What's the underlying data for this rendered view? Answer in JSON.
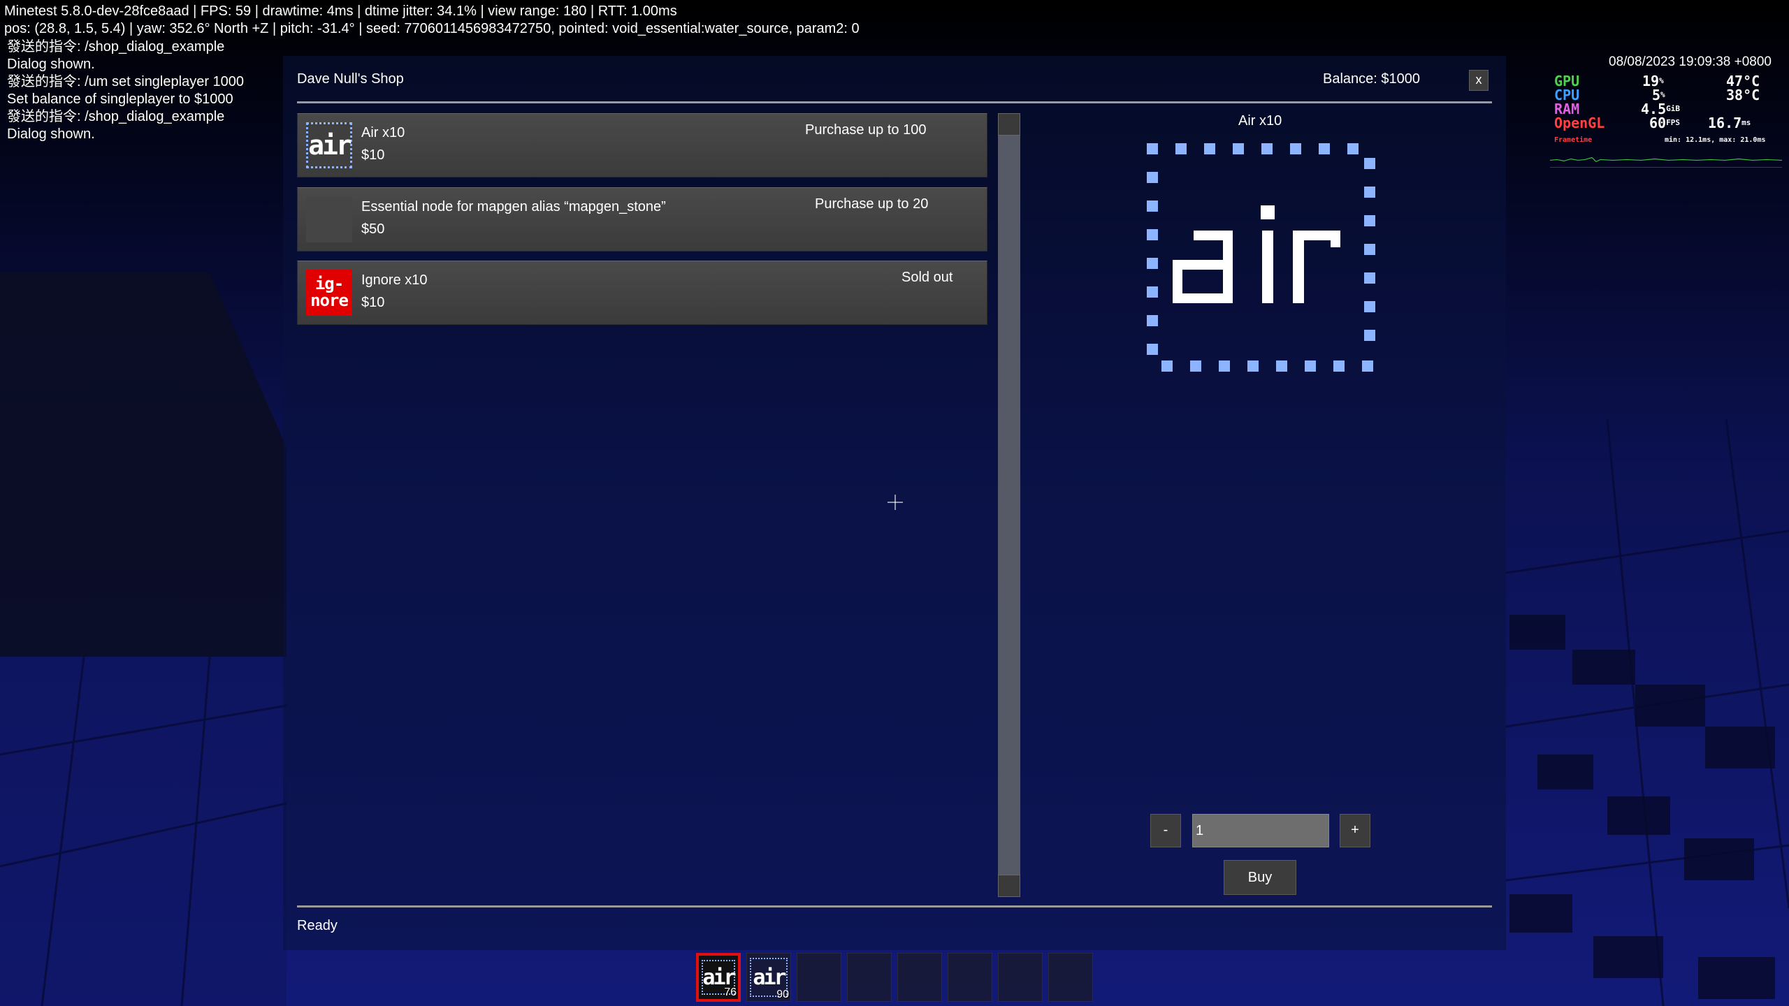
{
  "debug": {
    "line1": "Minetest 5.8.0-dev-28fce8aad | FPS: 59 | drawtime: 4ms | dtime jitter: 34.1% | view range: 180 | RTT: 1.00ms",
    "line2": "pos: (28.8, 1.5, 5.4) | yaw: 352.6° North +Z | pitch: -31.4° | seed: 7706011456983472750, pointed: void_essential:water_source, param2: 0"
  },
  "chat": [
    "發送的指令: /shop_dialog_example",
    "Dialog shown.",
    "發送的指令: /um set singleplayer 1000",
    "Set balance of singleplayer to $1000",
    "發送的指令: /shop_dialog_example",
    "Dialog shown."
  ],
  "overlay": {
    "clock": "08/08/2023 19:09:38 +0800",
    "gpu_label": "GPU",
    "gpu_value": "19",
    "gpu_unit": "%",
    "gpu_temp": "47°C",
    "cpu_label": "CPU",
    "cpu_value": "5",
    "cpu_unit": "%",
    "cpu_temp": "38°C",
    "ram_label": "RAM",
    "ram_value": "4.5",
    "ram_unit": "GiB",
    "opengl_label": "OpenGL",
    "fps_value": "60",
    "fps_unit": "FPS",
    "frametime_value": "16.7",
    "frametime_unit": "ms",
    "frametime_label": "Frametime",
    "frametime_stats": "min: 12.1ms, max: 21.0ms",
    "colors": {
      "gpu": "#4fd14f",
      "cpu": "#3fa0ff",
      "ram": "#e060e0",
      "opengl": "#ff4040"
    }
  },
  "dialog": {
    "title": "Dave Null's Shop",
    "balance": "Balance: $1000",
    "close_label": "x",
    "status": "Ready"
  },
  "items": [
    {
      "icon": "air-icon",
      "icon_text": "air",
      "name": "Air x10",
      "price": "$10",
      "availability": "Purchase up to 100"
    },
    {
      "icon": "stone-icon",
      "icon_text": "",
      "name": "Essential node for mapgen alias “mapgen_stone”",
      "price": "$50",
      "availability": "Purchase up to 20"
    },
    {
      "icon": "ignore-icon",
      "icon_text": "ig-\nnore",
      "name": "Ignore x10",
      "price": "$10",
      "availability": "Sold out"
    }
  ],
  "detail": {
    "title": "Air x10",
    "minus_label": "-",
    "plus_label": "+",
    "quantity": "1",
    "buy_label": "Buy"
  },
  "hotbar": {
    "slots": [
      {
        "icon": "air-icon",
        "label": "air",
        "count": "76",
        "selected": true
      },
      {
        "icon": "air-icon",
        "label": "air",
        "count": "90",
        "selected": false
      },
      {
        "empty": true
      },
      {
        "empty": true
      },
      {
        "empty": true
      },
      {
        "empty": true
      },
      {
        "empty": true
      },
      {
        "empty": true
      }
    ]
  }
}
